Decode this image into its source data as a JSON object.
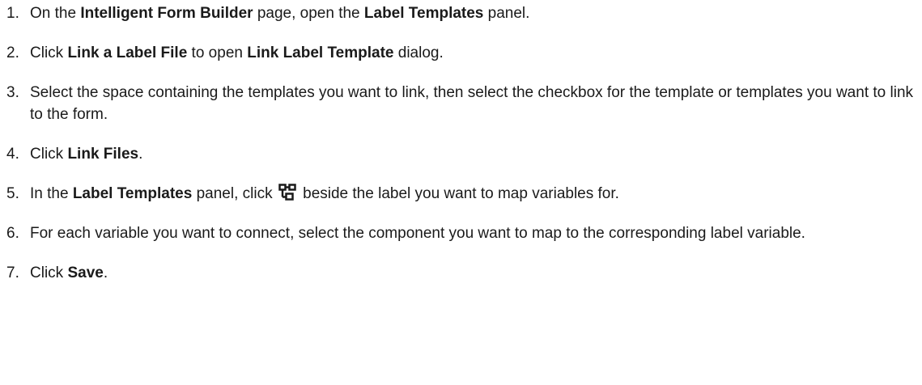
{
  "steps": [
    {
      "number": "1.",
      "parts": [
        {
          "text": "On the ",
          "bold": false
        },
        {
          "text": "Intelligent Form Builder",
          "bold": true
        },
        {
          "text": " page, open the ",
          "bold": false
        },
        {
          "text": "Label Templates",
          "bold": true
        },
        {
          "text": " panel.",
          "bold": false
        }
      ]
    },
    {
      "number": "2.",
      "parts": [
        {
          "text": "Click ",
          "bold": false
        },
        {
          "text": "Link a Label File",
          "bold": true
        },
        {
          "text": " to open ",
          "bold": false
        },
        {
          "text": "Link Label Template",
          "bold": true
        },
        {
          "text": " dialog.",
          "bold": false
        }
      ]
    },
    {
      "number": "3.",
      "parts": [
        {
          "text": "Select the space containing the templates you want to link, then select the checkbox for the template or templates you want to link to the form.",
          "bold": false
        }
      ]
    },
    {
      "number": "4.",
      "parts": [
        {
          "text": "Click ",
          "bold": false
        },
        {
          "text": "Link Files",
          "bold": true
        },
        {
          "text": ".",
          "bold": false
        }
      ]
    },
    {
      "number": "5.",
      "parts": [
        {
          "text": "In the ",
          "bold": false
        },
        {
          "text": "Label Templates",
          "bold": true
        },
        {
          "text": " panel, click ",
          "bold": false
        },
        {
          "icon": "map-variables-icon"
        },
        {
          "text": " beside the label you want to map variables for.",
          "bold": false
        }
      ]
    },
    {
      "number": "6.",
      "parts": [
        {
          "text": "For each variable you want to connect, select the component you want to map to the corresponding label variable.",
          "bold": false
        }
      ]
    },
    {
      "number": "7.",
      "parts": [
        {
          "text": "Click ",
          "bold": false
        },
        {
          "text": "Save",
          "bold": true
        },
        {
          "text": ".",
          "bold": false
        }
      ]
    }
  ]
}
